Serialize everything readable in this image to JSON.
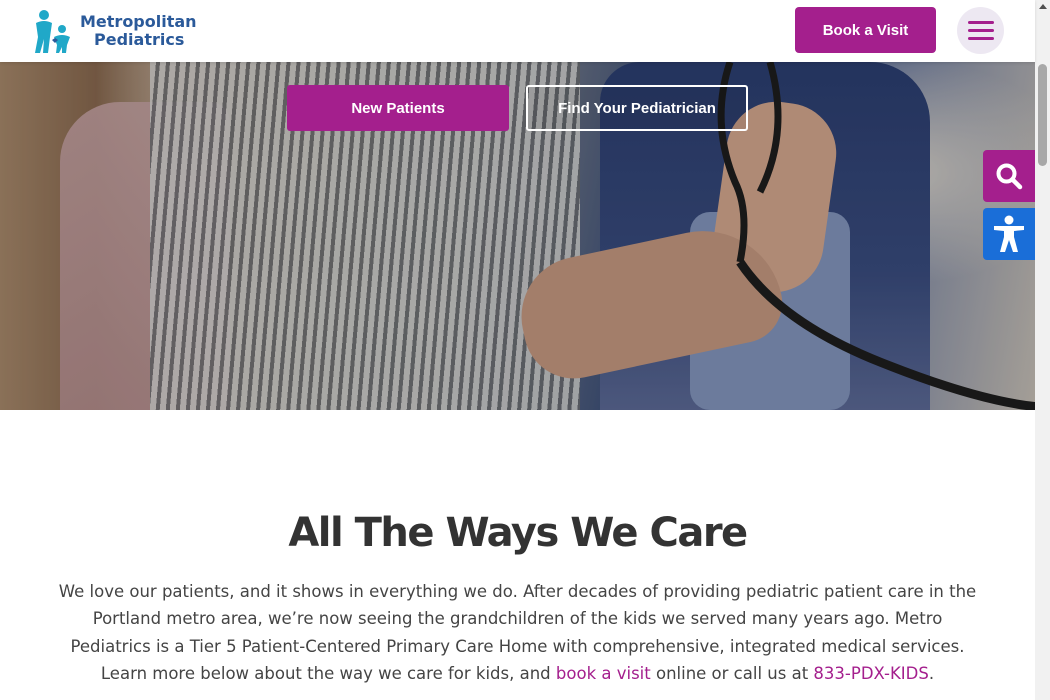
{
  "header": {
    "logo_line1": "Metropolitan",
    "logo_line2": "Pediatrics",
    "book_label": "Book a Visit",
    "menu_icon": "hamburger-icon"
  },
  "hero": {
    "new_patients_label": "New Patients",
    "find_pediatrician_label": "Find Your Pediatrician"
  },
  "side_tools": {
    "search_icon": "search-icon",
    "accessibility_icon": "accessibility-icon"
  },
  "main": {
    "title": "All The Ways We Care",
    "intro_text": "We love our patients, and it shows in everything we do. After decades of providing pediatric patient care in the Portland metro area, we’re now seeing the grandchildren of the kids we served many years ago. Metro Pediatrics is a Tier 5 Patient-Centered Primary Care Home with comprehensive, integrated medical services. Learn more below about the way we care for kids, and",
    "book_link": "book a visit",
    "mid_text": "online or call us at",
    "phone_link": "833-PDX-KIDS",
    "end_text": "."
  },
  "colors": {
    "brand_magenta": "#a41f8d",
    "brand_blue": "#2b5a9a",
    "logo_teal": "#20a8c8",
    "accessibility_blue": "#1a6ed8"
  }
}
